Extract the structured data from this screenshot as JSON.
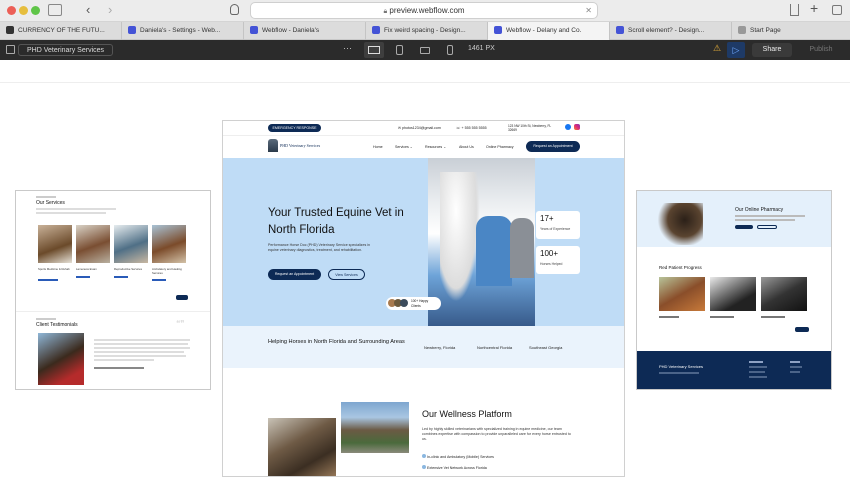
{
  "browser": {
    "url": "preview.webflow.com",
    "tabs": [
      {
        "label": "CURRENCY OF THE FUTU...",
        "active": false
      },
      {
        "label": "Daniela's - Settings - Web...",
        "active": false
      },
      {
        "label": "Webflow - Daniela's",
        "active": false
      },
      {
        "label": "Fix weird spacing - Design...",
        "active": false
      },
      {
        "label": "Webflow - Delany and Co.",
        "active": true
      },
      {
        "label": "Scroll element? - Design...",
        "active": false
      },
      {
        "label": "Start Page",
        "active": false
      }
    ]
  },
  "webflow_bar": {
    "site_name": "PHD Veterinary Services",
    "width_label": "1461 PX",
    "share_label": "Share",
    "publish_label": "Publish"
  },
  "site": {
    "emergency_button": "EMERGENCY RESPONSE",
    "email": "photos1234@gmail.com",
    "phone": "+ 555 555 5555",
    "address": "123 NW 10th St, Newberry, FL 32669",
    "logo_text": "PHD Veterinary Services",
    "nav": [
      "Home",
      "Services",
      "Resources",
      "About Us",
      "Online Pharmacy"
    ],
    "nav_cta": "Request an Appointment",
    "hero": {
      "title": "Your Trusted Equine Vet in North Florida",
      "desc": "Performance Horse Doc (PHD) Veterinary Service specializes in equine veterinary diagnostics, treatment, and rehabilitation.",
      "btn_primary": "Request an Appointment",
      "btn_secondary": "View Services",
      "stat1_value": "17+",
      "stat1_label": "Years of Experience",
      "stat2_value": "100+",
      "stat2_label": "Horses Helped",
      "clients_value": "100+ Happy",
      "clients_label": "Clients"
    },
    "areas": {
      "title": "Helping Horses in North Florida and Surrounding Areas",
      "items": [
        "Newberry, Florida",
        "Northcentral Florida",
        "Southeast Georgia"
      ]
    },
    "wellness": {
      "title": "Our Wellness Platform",
      "desc": "Led by highly skilled veterinarians with specialized training in equine medicine, our team combines expertise with compassion to provide unparalleled care for every horse entrusted to us.",
      "items": [
        "In-clinic and Ambulatory (Mobile) Services",
        "Extensive Vet Network Across Florida"
      ]
    }
  },
  "left_preview": {
    "services_title": "Our Services",
    "service_items": [
      "Sports Medicine & Rehab",
      "Lameness Exam",
      "Reproductive Services",
      "Ambulatory and Hauling Services"
    ],
    "testimonials_title": "Client Testimonials"
  },
  "right_preview": {
    "pharmacy_title": "Our Online Pharmacy",
    "findings_title": "Red Patient Progress",
    "footer_brand": "PHD Veterinary Services"
  },
  "colors": {
    "accent": "#0d2a55",
    "hero_bg": "#bfdcf6",
    "webflow_bar": "#2b2b2b",
    "tab_icon": "#4453d6"
  }
}
